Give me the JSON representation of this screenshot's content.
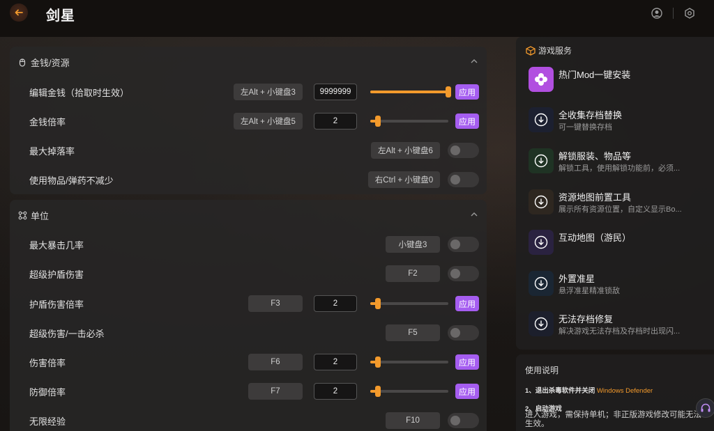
{
  "app": {
    "title": "剑星"
  },
  "sections": {
    "money": {
      "title": "金钱/资源",
      "rows": [
        {
          "label": "编辑金钱（拾取时生效）",
          "hotkey": "左Alt + 小键盘3",
          "value": "9999999",
          "slider": 1.0,
          "apply": "应用"
        },
        {
          "label": "金钱倍率",
          "hotkey": "左Alt + 小键盘5",
          "value": "2",
          "slider": 0.1,
          "apply": "应用"
        },
        {
          "label": "最大掉落率",
          "hotkey": "左Alt + 小键盘6"
        },
        {
          "label": "使用物品/弹药不减少",
          "hotkey": "右Ctrl + 小键盘0"
        }
      ]
    },
    "unit": {
      "title": "单位",
      "rows": [
        {
          "label": "最大暴击几率",
          "hotkey": "小键盘3"
        },
        {
          "label": "超级护盾伤害",
          "hotkey": "F2"
        },
        {
          "label": "护盾伤害倍率",
          "hotkey": "F3",
          "value": "2",
          "slider": 0.1,
          "apply": "应用"
        },
        {
          "label": "超级伤害/一击必杀",
          "hotkey": "F5"
        },
        {
          "label": "伤害倍率",
          "hotkey": "F6",
          "value": "2",
          "slider": 0.1,
          "apply": "应用"
        },
        {
          "label": "防御倍率",
          "hotkey": "F7",
          "value": "2",
          "slider": 0.1,
          "apply": "应用"
        },
        {
          "label": "无限经验",
          "hotkey": "F10"
        }
      ]
    }
  },
  "services": {
    "title": "游戏服务",
    "items": [
      {
        "title": "热门Mod一键安装",
        "desc": "",
        "icon": "mod-flower-icon",
        "color": "#b14fe0"
      },
      {
        "title": "全收集存档替换",
        "desc": "可一键替换存档",
        "icon": "download-icon",
        "color": "#1c2030"
      },
      {
        "title": "解锁服装、物品等",
        "desc": "解锁工具，使用解锁功能前，必须...",
        "icon": "download-icon",
        "color": "#1f3324"
      },
      {
        "title": "资源地图前置工具",
        "desc": "展示所有资源位置，自定义显示Bo...",
        "icon": "download-icon",
        "color": "#2e2720"
      },
      {
        "title": "互动地图（游民）",
        "desc": "",
        "icon": "download-icon",
        "color": "#2a2240"
      },
      {
        "title": "外置准星",
        "desc": "悬浮准星精准锁敌",
        "icon": "download-icon",
        "color": "#1a2633"
      },
      {
        "title": "无法存档修复",
        "desc": "解决游戏无法存档及存档时出现闪...",
        "icon": "download-icon",
        "color": "#1c1f2c"
      }
    ]
  },
  "guide": {
    "title": "使用说明",
    "step1": "1、退出杀毒软件并关闭",
    "step1_link": "Windows Defender",
    "step2": "2、启动游戏",
    "step2_text": "进入游戏，需保持单机；非正版游戏修改可能无法生效。"
  },
  "colors": {
    "accent": "#f39a2c",
    "apply": "#a55df0"
  }
}
